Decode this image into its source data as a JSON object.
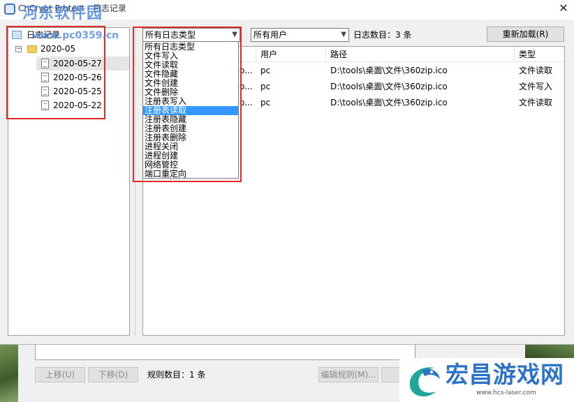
{
  "window": {
    "title": "CnCrypt Protect - 日志记录",
    "close_glyph": "✕"
  },
  "watermark": {
    "line1": "河东软件园",
    "line2": "www.pc0359.cn"
  },
  "tree": {
    "root": "日志记录",
    "folder": "2020-05",
    "collapse_glyph": "−",
    "dates": [
      "2020-05-27",
      "2020-05-26",
      "2020-05-25",
      "2020-05-22"
    ]
  },
  "toolbar": {
    "type_filter": "所有日志类型",
    "user_filter": "所有用户",
    "log_count": "日志数目：3 条",
    "reload_label": "重新加载(R)"
  },
  "dropdown": {
    "options": [
      "所有日志类型",
      "文件写入",
      "文件读取",
      "文件隐藏",
      "文件创建",
      "文件删除",
      "注册表写入",
      "注册表读取",
      "注册表隐藏",
      "注册表创建",
      "注册表删除",
      "进程关闭",
      "进程创建",
      "网络管控",
      "端口重定向"
    ],
    "highlighted_index": 7
  },
  "list": {
    "columns": [
      "用户",
      "路径",
      "类型"
    ],
    "rows": [
      {
        "time_fragment": "o...",
        "user": "pc",
        "path": "D:\\tools\\桌面\\文件\\360zip.ico",
        "type": "文件读取"
      },
      {
        "time_fragment": "o...",
        "user": "pc",
        "path": "D:\\tools\\桌面\\文件\\360zip.ico",
        "type": "文件写入"
      },
      {
        "time_fragment": "o...",
        "user": "pc",
        "path": "D:\\tools\\桌面\\文件\\360zip.ico",
        "type": "文件读取"
      }
    ]
  },
  "background_app": {
    "move_up": "上移(U)",
    "move_down": "下移(D)",
    "rule_count": "规则数目：1 条",
    "edit_rule": "编辑规则(M)..."
  },
  "brand": {
    "name": "宏昌游戏网",
    "url": "www.hcs-laser.com"
  },
  "colors": {
    "highlight_blue": "#3399ff",
    "annotation_red": "#e02a2a",
    "brand_blue": "#2a73c8"
  }
}
